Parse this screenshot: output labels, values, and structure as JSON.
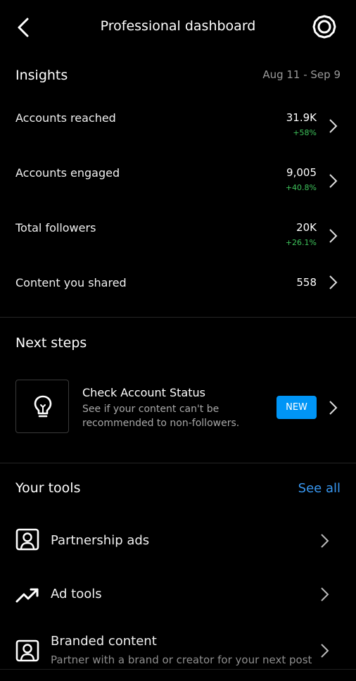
{
  "header": {
    "title": "Professional dashboard"
  },
  "insights": {
    "title": "Insights",
    "date_range": "Aug 11 - Sep 9",
    "rows": [
      {
        "label": "Accounts reached",
        "value": "31.9K",
        "delta": "+58%"
      },
      {
        "label": "Accounts engaged",
        "value": "9,005",
        "delta": "+40.8%"
      },
      {
        "label": "Total followers",
        "value": "20K",
        "delta": "+26.1%"
      },
      {
        "label": "Content you shared",
        "value": "558",
        "delta": ""
      }
    ]
  },
  "next_steps": {
    "title": "Next steps",
    "card": {
      "icon": "lightbulb-icon",
      "title": "Check Account Status",
      "description": "See if your content can't be recommended to non-followers.",
      "badge": "NEW"
    }
  },
  "tools": {
    "title": "Your tools",
    "see_all": "See all",
    "items": [
      {
        "label": "Partnership ads",
        "description": "",
        "icon": "portrait-icon"
      },
      {
        "label": "Ad tools",
        "description": "",
        "icon": "trending-up-icon"
      },
      {
        "label": "Branded content",
        "description": "Partner with a brand or creator for your next post",
        "icon": "portrait-icon"
      }
    ]
  },
  "colors": {
    "accent": "#0095f6",
    "link": "#3897f0",
    "positive": "#3ec35b",
    "muted": "#9a9a9a"
  }
}
